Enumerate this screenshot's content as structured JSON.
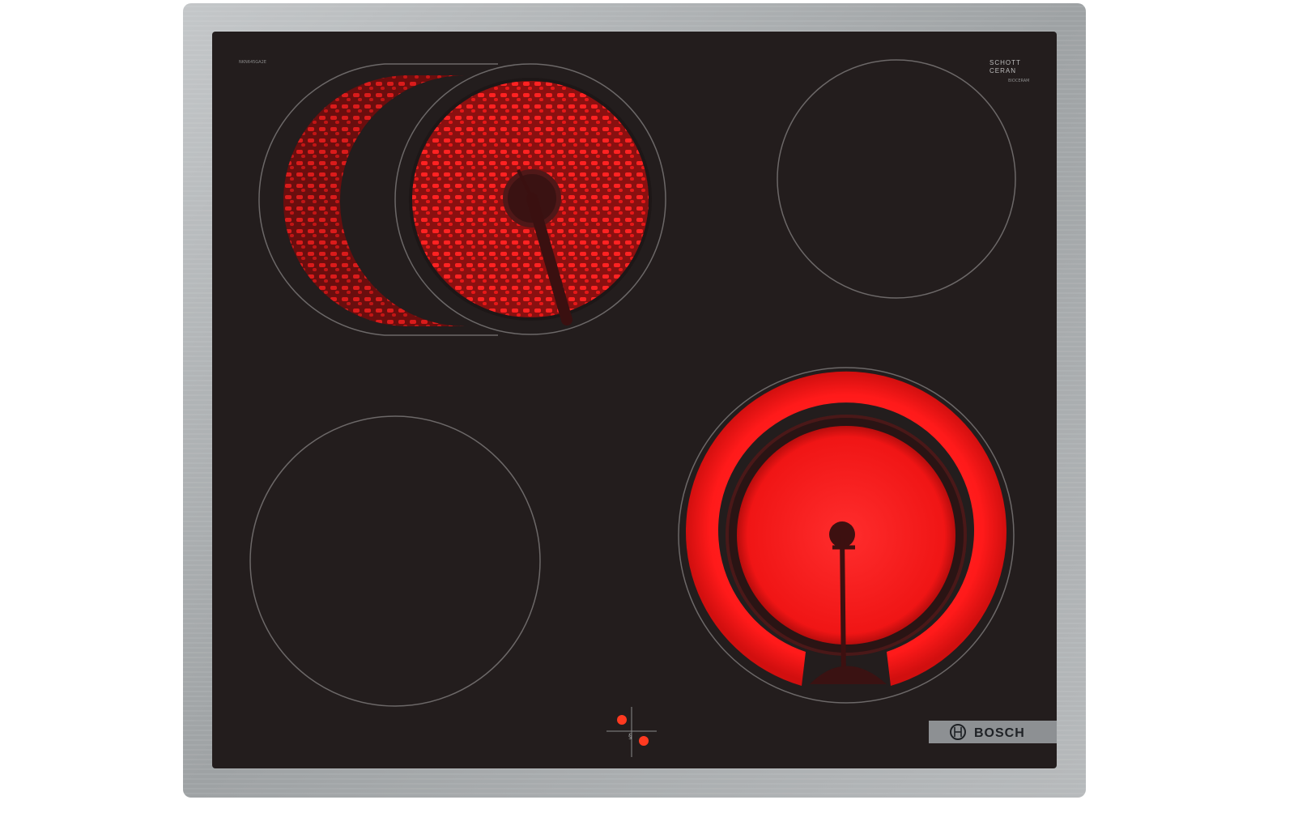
{
  "product": {
    "model_code": "NKN645GA2E",
    "glass_brand_line1": "SCHOTT",
    "glass_brand_line2": "CERAN",
    "glass_brand_sub": "BIOCERAM",
    "brand": "BOSCH"
  },
  "cooking_zones": [
    {
      "id": "front-left",
      "state": "off"
    },
    {
      "id": "rear-left-extendable",
      "state": "glowing",
      "extended": true
    },
    {
      "id": "rear-right",
      "state": "off"
    },
    {
      "id": "front-right-dual",
      "state": "glowing",
      "dual_ring": true
    }
  ],
  "indicator_lights": [
    {
      "id": "residual-heat-1",
      "state": "on"
    },
    {
      "id": "residual-heat-2",
      "state": "on"
    }
  ],
  "colors": {
    "frame": "#a8abad",
    "glass": "#231d1d",
    "glow": "#ff1a1a",
    "ring_line": "#6c6868"
  }
}
